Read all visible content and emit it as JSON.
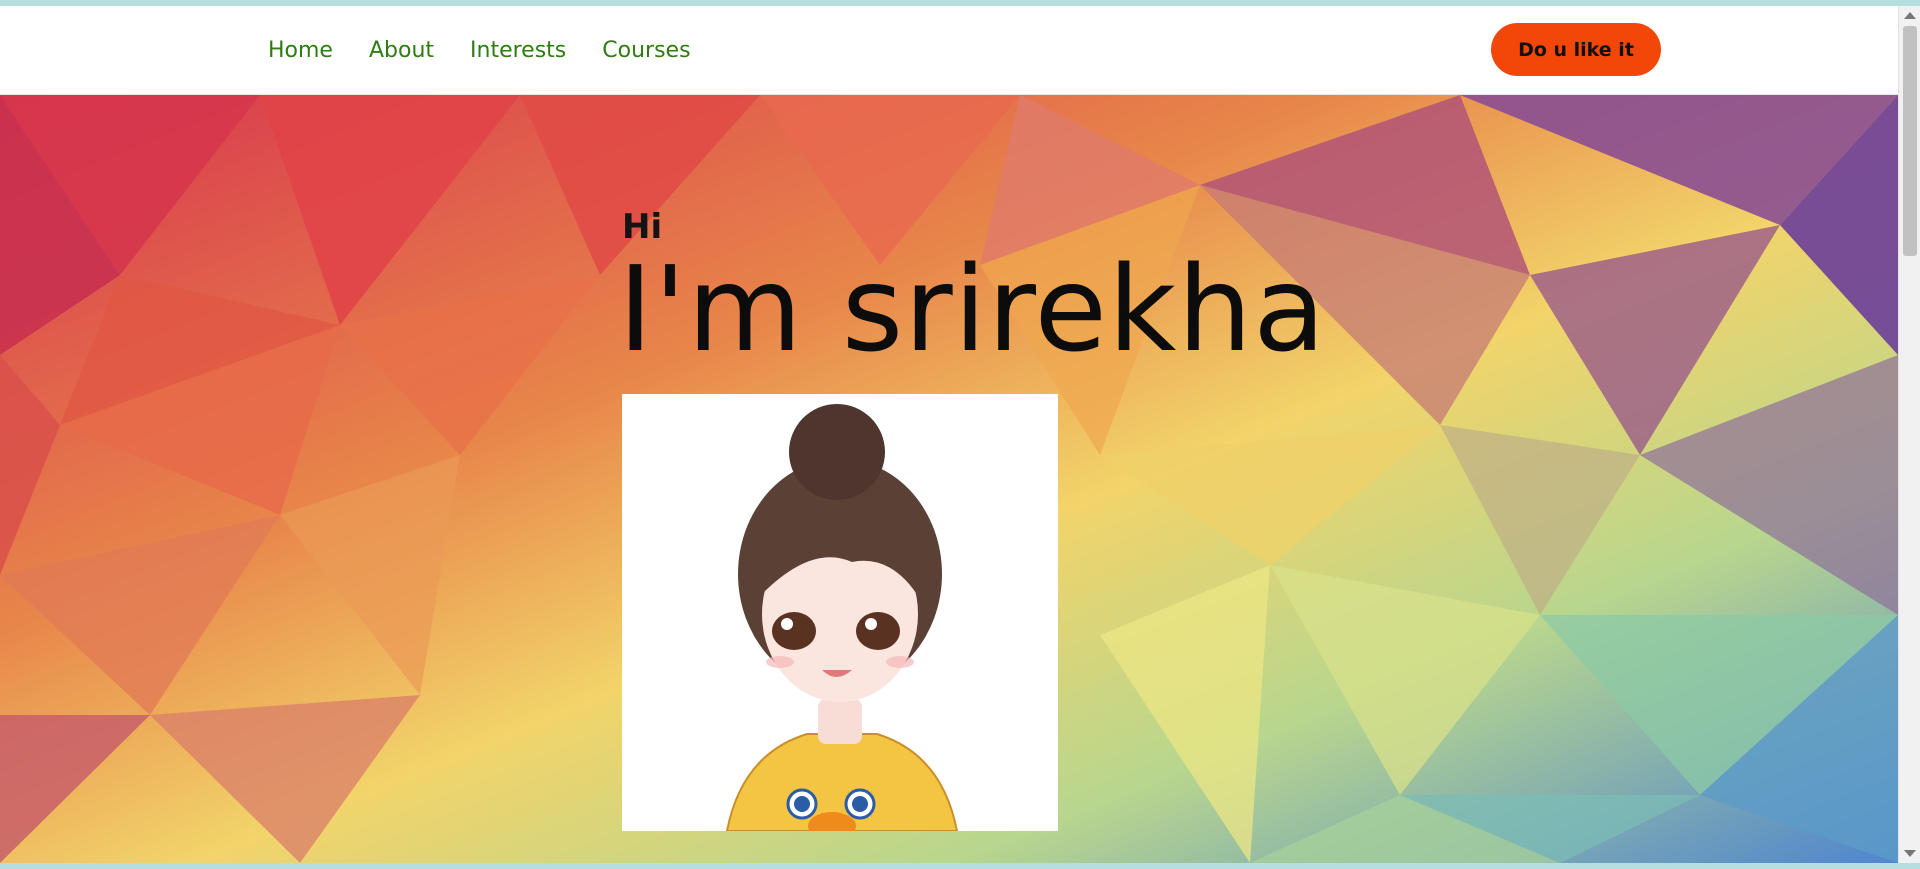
{
  "nav": {
    "links": [
      {
        "label": "Home"
      },
      {
        "label": "About"
      },
      {
        "label": "Interests"
      },
      {
        "label": "Courses"
      }
    ],
    "cta_label": "Do u like it"
  },
  "hero": {
    "greeting": "Hi",
    "name_line": "I'm srirekha",
    "avatar_alt": "cartoon girl with hair bun wearing yellow duck shirt"
  },
  "colors": {
    "nav_link": "#2e7d12",
    "cta_bg": "#f24708"
  }
}
